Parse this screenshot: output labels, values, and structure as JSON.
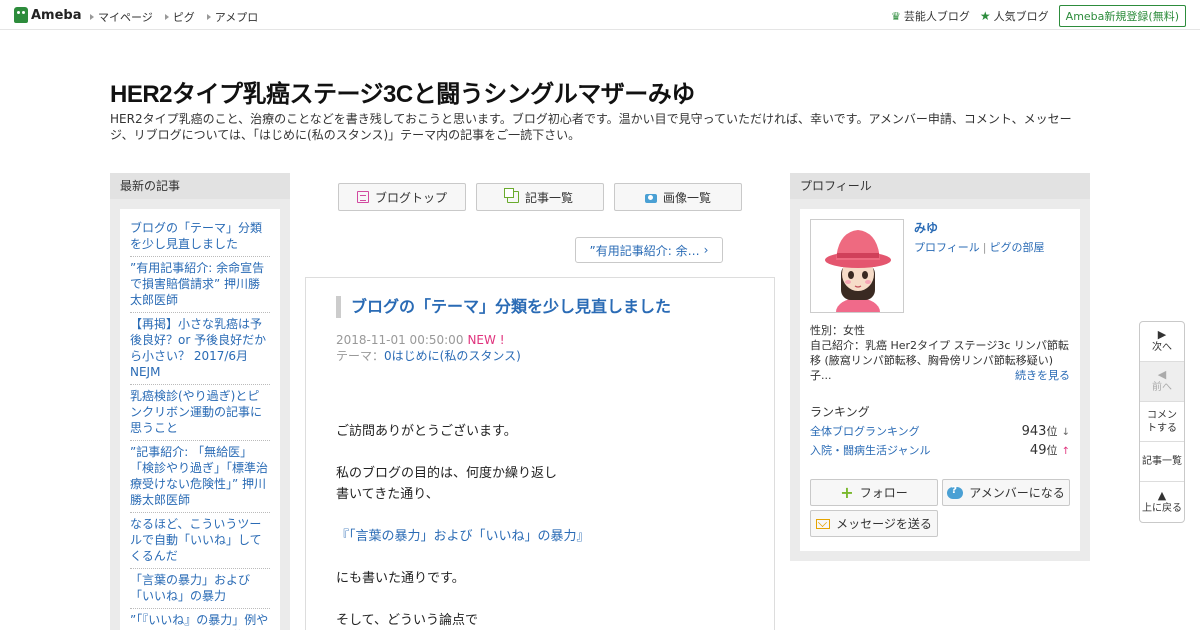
{
  "topbar": {
    "logo": "Ameba",
    "nav": [
      "マイページ",
      "ピグ",
      "アメプロ"
    ],
    "celeb_blog": "芸能人ブログ",
    "popular_blog": "人気ブログ",
    "signup": "Ameba新規登録(無料)"
  },
  "header": {
    "title": "HER2タイプ乳癌ステージ3Cと闘うシングルマザーみゆ",
    "description": "HER2タイプ乳癌のこと、治療のことなどを書き残しておこうと思います。ブログ初心者です。温かい目で見守っていただければ、幸いです。アメンバー申請、コメント、メッセージ、リブログについては、「はじめに(私のスタンス)」テーマ内の記事をご一読下さい。"
  },
  "left_sidebar": {
    "heading": "最新の記事",
    "items": [
      "ブログの「テーマ」分類を少し見直しました",
      "”有用記事紹介: 余命宣告で損害賠償請求” 押川勝太郎医師",
      "【再掲】小さな乳癌は予後良好？or 予後良好だから小さい？ 2017/6月 NEJM",
      "乳癌検診(やり過ぎ)とピンクリボン運動の記事に思うこと",
      "”記事紹介: 「無給医」「検診やり過ぎ」「標準治療受けない危険性」” 押川勝太郎医師",
      "なるほど、こういうツールで自動「いいね」してくるんだ",
      "「言葉の暴力」および「いいね」の暴力",
      "”「『いいね』の暴力」例やめて下さい”のその後"
    ]
  },
  "center": {
    "buttons": {
      "blog_top": "ブログトップ",
      "article_list": "記事一覧",
      "image_list": "画像一覧"
    },
    "prev_article": "”有用記事紹介: 余…",
    "article": {
      "title": "ブログの「テーマ」分類を少し見直しました",
      "date": "2018-11-01 00:50:00",
      "new_badge": "NEW !",
      "theme_label": "テーマ：",
      "theme": "0はじめに(私のスタンス)",
      "body": {
        "p1": "ご訪問ありがとうございます。",
        "p2a": "私のブログの目的は、何度か繰り返し",
        "p2b": "書いてきた通り、",
        "p3": "『「言葉の暴力」および「いいね」の暴力』",
        "p4": "にも書いた通りです。",
        "p5": "そして、どういう論点で"
      }
    }
  },
  "right_sidebar": {
    "heading": "プロフィール",
    "name": "みゆ",
    "profile_link": "プロフィール",
    "pig_link": "ピグの部屋",
    "gender": "性別：女性",
    "intro": "自己紹介：乳癌 Her2タイプ ステージ3c リンパ節転移 (腋窩リンパ節転移、胸骨傍リンパ節転移疑い) 子...",
    "more": "続きを見る",
    "ranking_heading": "ランキング",
    "rankings": [
      {
        "label": "全体ブログランキング",
        "value": "943",
        "unit": "位",
        "trend": "↓"
      },
      {
        "label": "入院・闘病生活ジャンル",
        "value": "49",
        "unit": "位",
        "trend": "↑"
      }
    ],
    "follow": "フォロー",
    "amember": "アメンバーになる",
    "message": "メッセージを送る"
  },
  "floatnav": {
    "next": "次へ",
    "prev": "前へ",
    "comment": "コメントする",
    "list": "記事一覧",
    "top": "上に戻る"
  },
  "colors": {
    "brand_green": "#2d8c3c",
    "link_blue": "#2a6bb5",
    "new_pink": "#e0337d"
  }
}
